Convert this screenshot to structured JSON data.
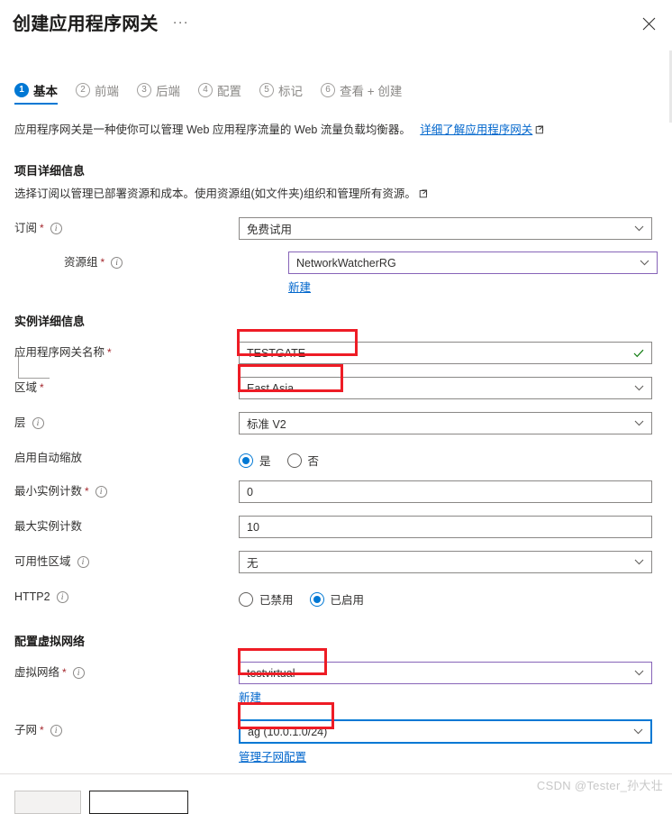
{
  "blade": {
    "title": "创建应用程序网关",
    "ellipsis": "···",
    "close_label": "关闭"
  },
  "wizard": {
    "tabs": [
      {
        "num": "1",
        "label": "基本",
        "active": true
      },
      {
        "num": "2",
        "label": "前端",
        "active": false
      },
      {
        "num": "3",
        "label": "后端",
        "active": false
      },
      {
        "num": "4",
        "label": "配置",
        "active": false
      },
      {
        "num": "5",
        "label": "标记",
        "active": false
      },
      {
        "num": "6",
        "label": "查看 + 创建",
        "active": false
      }
    ]
  },
  "intro": {
    "text": "应用程序网关是一种使你可以管理 Web 应用程序流量的 Web 流量负载均衡器。",
    "link": "详细了解应用程序网关"
  },
  "project_details": {
    "title": "项目详细信息",
    "description": "选择订阅以管理已部署资源和成本。使用资源组(如文件夹)组织和管理所有资源。",
    "subscription": {
      "label": "订阅",
      "required": "*",
      "value": "免费试用"
    },
    "resource_group": {
      "label": "资源组",
      "required": "*",
      "value": "NetworkWatcherRG",
      "new_link": "新建"
    }
  },
  "instance_details": {
    "title": "实例详细信息",
    "gateway_name": {
      "label": "应用程序网关名称",
      "required": "*",
      "value": "TESTGATE"
    },
    "region": {
      "label": "区域",
      "required": "*",
      "value": "East Asia"
    },
    "tier": {
      "label": "层",
      "value": "标准 V2"
    },
    "autoscale": {
      "label": "启用自动缩放",
      "options": [
        "是",
        "否"
      ],
      "selected": "是"
    },
    "min_instance": {
      "label": "最小实例计数",
      "required": "*",
      "value": "0"
    },
    "max_instance": {
      "label": "最大实例计数",
      "value": "10"
    },
    "availability_zone": {
      "label": "可用性区域",
      "value": "无"
    },
    "http2": {
      "label": "HTTP2",
      "options": [
        "已禁用",
        "已启用"
      ],
      "selected": "已启用"
    }
  },
  "vnet_config": {
    "title": "配置虚拟网络",
    "virtual_network": {
      "label": "虚拟网络",
      "required": "*",
      "value": "testvirtual",
      "new_link": "新建"
    },
    "subnet": {
      "label": "子网",
      "required": "*",
      "value": "ag (10.0.1.0/24)",
      "manage_link": "管理子网配置"
    }
  },
  "footer": {
    "previous_label": "",
    "next_label": ""
  },
  "watermark": "CSDN @Tester_孙大壮",
  "colors": {
    "accent": "#0078d4",
    "link": "#0066cc",
    "required": "#a4262c",
    "annotation": "#ee1c25",
    "purple_border": "#8764b8",
    "valid_check": "#107c10"
  }
}
